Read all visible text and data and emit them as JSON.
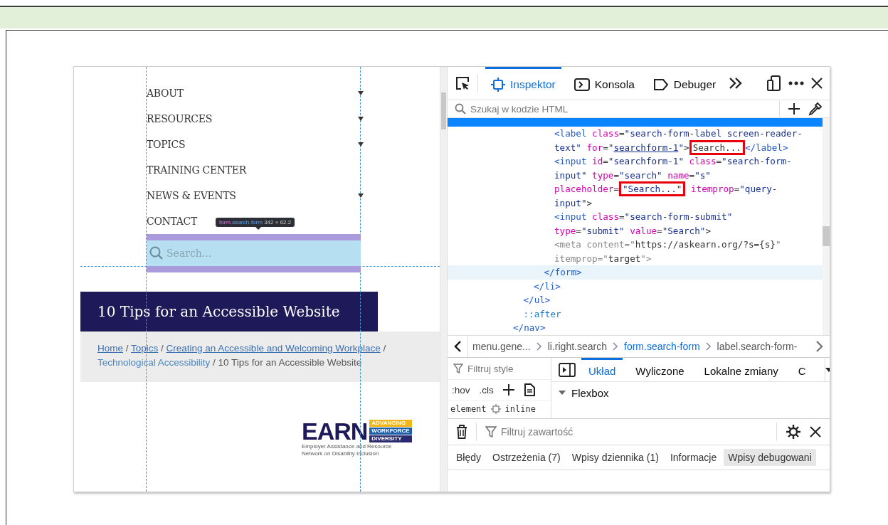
{
  "page": {
    "nav_items": [
      {
        "label": "ABOUT",
        "has_submenu": true
      },
      {
        "label": "RESOURCES",
        "has_submenu": true
      },
      {
        "label": "TOPICS",
        "has_submenu": true
      },
      {
        "label": "TRAINING CENTER",
        "has_submenu": false
      },
      {
        "label": "NEWS & EVENTS",
        "has_submenu": true
      },
      {
        "label": "CONTACT",
        "has_submenu": false
      }
    ],
    "tooltip": {
      "tag": "form",
      "class_name": ".search-form",
      "size": "342 × 62.2"
    },
    "search": {
      "placeholder": "Search..."
    },
    "title": "10 Tips for an Accessible Website",
    "breadcrumb": [
      {
        "kind": "link",
        "text": "Home"
      },
      {
        "kind": "text",
        "text": " / "
      },
      {
        "kind": "link",
        "text": "Topics"
      },
      {
        "kind": "text",
        "text": " / "
      },
      {
        "kind": "link",
        "text": "Creating an Accessible and Welcoming Workplace"
      },
      {
        "kind": "text",
        "text": " / "
      },
      {
        "kind": "plain-link",
        "text": "Technological Accessibility"
      },
      {
        "kind": "text",
        "text": " / 10 Tips for an Accessible Website"
      }
    ],
    "logo": {
      "name": "EARN",
      "tags": [
        {
          "text": "ADVANCING",
          "color": "#f2b51c"
        },
        {
          "text": "WORKFORCE",
          "color": "#1f5fa8"
        },
        {
          "text": "DIVERSITY",
          "color": "#2b2a6e"
        }
      ],
      "tagline": "Employer Assistance and Resource Network on Disability Inclusion"
    }
  },
  "devtools": {
    "tabs": [
      {
        "label": "Inspektor",
        "kind": "inspector",
        "selected": true
      },
      {
        "label": "Konsola",
        "kind": "console",
        "selected": false
      },
      {
        "label": "Debuger",
        "kind": "debugger",
        "selected": false
      }
    ],
    "search": {
      "placeholder": "Szukaj w kodzie HTML"
    },
    "markup": [
      {
        "close": [
          {
            "kind": "tag",
            "text": "</nav>"
          }
        ],
        "children": [
          {
            "close": [
              {
                "kind": "tag",
                "text": "</ul>"
              }
            ],
            "children": [
              {
                "close": [
                  {
                    "kind": "tag",
                    "text": "</li>"
                  }
                ],
                "children": [
                  {
                    "hovered": true,
                    "close": [
                      {
                        "kind": "tag",
                        "text": "</form>"
                      }
                    ],
                    "children": [
                      {
                        "open": [
                          [
                            {
                              "kind": "tag",
                              "text": "<label"
                            },
                            {
                              "kind": "attr",
                              "text": " class"
                            },
                            {
                              "kind": "punct",
                              "text": "="
                            },
                            {
                              "kind": "val",
                              "text": "\"search-form-label screen-reader-"
                            }
                          ],
                          [
                            {
                              "kind": "val",
                              "text": "text\""
                            },
                            {
                              "kind": "attr",
                              "text": " for"
                            },
                            {
                              "kind": "punct",
                              "text": "=\""
                            },
                            {
                              "kind": "link",
                              "text": "searchform-1"
                            },
                            {
                              "kind": "val",
                              "text": "\""
                            },
                            {
                              "kind": "punct",
                              "text": ">"
                            },
                            {
                              "kind": "text",
                              "text": "Search...",
                              "boxed": true
                            },
                            {
                              "kind": "tag",
                              "text": "</label>"
                            }
                          ]
                        ]
                      },
                      {
                        "open": [
                          [
                            {
                              "kind": "tag",
                              "text": "<input"
                            },
                            {
                              "kind": "attr",
                              "text": " id"
                            },
                            {
                              "kind": "punct",
                              "text": "="
                            },
                            {
                              "kind": "val",
                              "text": "\"searchform-1\""
                            },
                            {
                              "kind": "attr",
                              "text": " class"
                            },
                            {
                              "kind": "punct",
                              "text": "="
                            },
                            {
                              "kind": "val",
                              "text": "\"search-form-"
                            }
                          ],
                          [
                            {
                              "kind": "val",
                              "text": "input\""
                            },
                            {
                              "kind": "attr",
                              "text": " type"
                            },
                            {
                              "kind": "punct",
                              "text": "="
                            },
                            {
                              "kind": "val",
                              "text": "\"search\""
                            },
                            {
                              "kind": "attr",
                              "text": " name"
                            },
                            {
                              "kind": "punct",
                              "text": "="
                            },
                            {
                              "kind": "val",
                              "text": "\"s\""
                            }
                          ],
                          [
                            {
                              "kind": "attr",
                              "text": "placeholder"
                            },
                            {
                              "kind": "punct",
                              "text": "="
                            },
                            {
                              "kind": "val",
                              "text": "\"Search...\"",
                              "boxed": true
                            },
                            {
                              "kind": "attr",
                              "text": " itemprop"
                            },
                            {
                              "kind": "punct",
                              "text": "="
                            },
                            {
                              "kind": "val",
                              "text": "\"query-"
                            }
                          ],
                          [
                            {
                              "kind": "val",
                              "text": "input\""
                            },
                            {
                              "kind": "punct",
                              "text": ">"
                            }
                          ]
                        ]
                      },
                      {
                        "open": [
                          [
                            {
                              "kind": "tag",
                              "text": "<input"
                            },
                            {
                              "kind": "attr",
                              "text": " class"
                            },
                            {
                              "kind": "punct",
                              "text": "="
                            },
                            {
                              "kind": "val",
                              "text": "\"search-form-submit\""
                            }
                          ],
                          [
                            {
                              "kind": "attr",
                              "text": "type"
                            },
                            {
                              "kind": "punct",
                              "text": "="
                            },
                            {
                              "kind": "val",
                              "text": "\"submit\""
                            },
                            {
                              "kind": "attr",
                              "text": " value"
                            },
                            {
                              "kind": "punct",
                              "text": "="
                            },
                            {
                              "kind": "val",
                              "text": "\"Search\""
                            },
                            {
                              "kind": "punct",
                              "text": ">"
                            }
                          ]
                        ]
                      },
                      {
                        "open": [
                          [
                            {
                              "kind": "dim",
                              "text": "<meta content=\""
                            },
                            {
                              "kind": "text",
                              "text": "https://askearn.org/?s={s}"
                            },
                            {
                              "kind": "dim",
                              "text": "\""
                            }
                          ],
                          [
                            {
                              "kind": "dim",
                              "text": "itemprop=\""
                            },
                            {
                              "kind": "text",
                              "text": "target"
                            },
                            {
                              "kind": "dim",
                              "text": "\">"
                            }
                          ]
                        ]
                      }
                    ]
                  }
                ]
              }
            ]
          },
          {
            "open": [
              [
                {
                  "kind": "pseudo",
                  "text": "::after"
                }
              ]
            ]
          }
        ]
      }
    ],
    "breadcrumbs": [
      {
        "label": "menu.gene...",
        "selected": false
      },
      {
        "label": "li.right.search",
        "selected": false
      },
      {
        "label": "form.search-form",
        "selected": true
      },
      {
        "label": "label.search-form-",
        "selected": false
      }
    ],
    "styles": {
      "filter_placeholder": "Filtruj style",
      "toggles": [
        ":hov",
        ".cls"
      ],
      "rule_selector": "element",
      "rule_origin": "inline"
    },
    "layout_tabs": [
      {
        "label": "Układ",
        "selected": true
      },
      {
        "label": "Wyliczone",
        "selected": false
      },
      {
        "label": "Lokalne zmiany",
        "selected": false
      },
      {
        "label": "C",
        "selected": false
      }
    ],
    "layout_section": {
      "title": "Flexbox",
      "expanded": true
    },
    "console": {
      "filter_placeholder": "Filtruj zawartość",
      "filters": [
        {
          "label": "Błędy",
          "selected": false
        },
        {
          "label": "Ostrzeżenia (7)",
          "selected": false
        },
        {
          "label": "Wpisy dziennika (1)",
          "selected": false
        },
        {
          "label": "Informacje",
          "selected": false
        },
        {
          "label": "Wpisy debugowani",
          "selected": true
        }
      ]
    }
  }
}
